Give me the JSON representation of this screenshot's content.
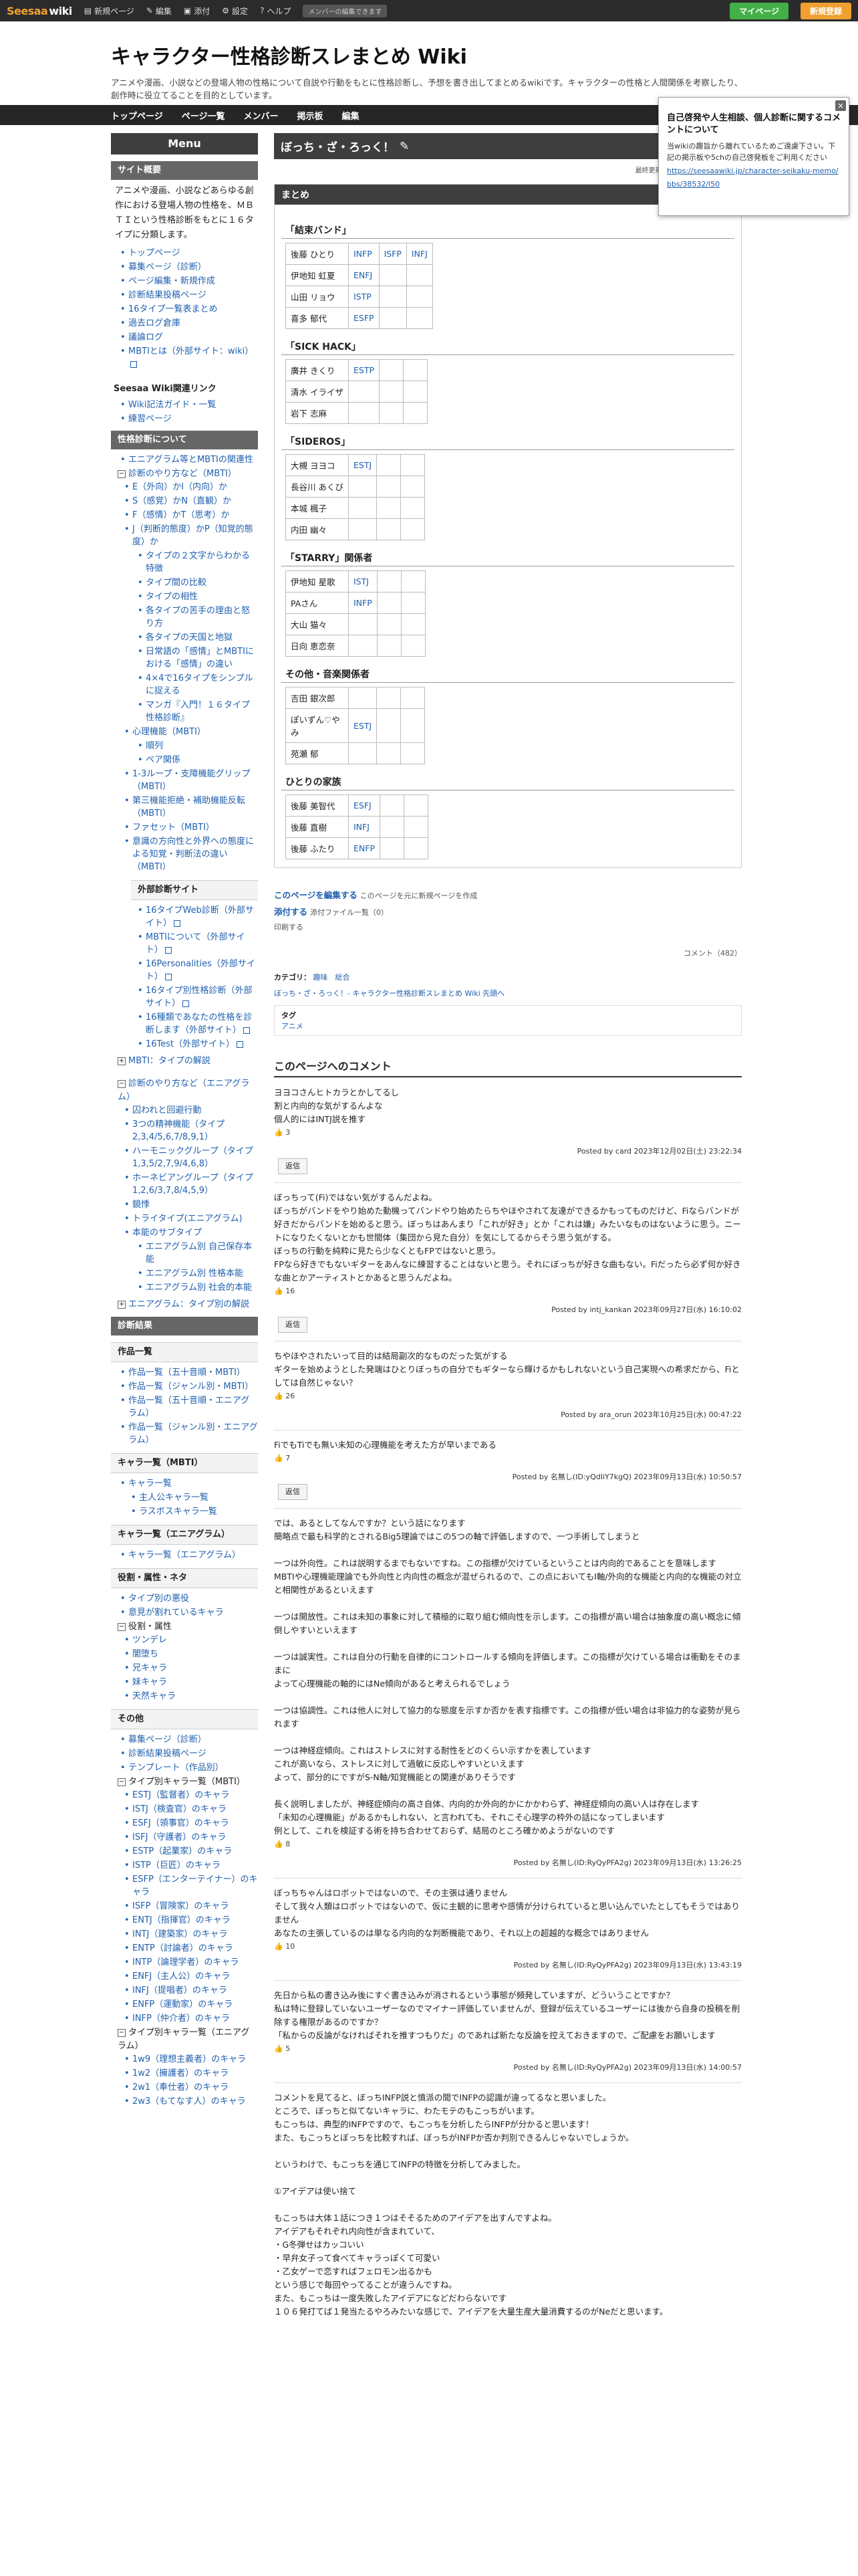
{
  "topbar": {
    "logo_main": "Seesaa",
    "logo_sub": "wiki",
    "items": [
      "新規ページ",
      "編集",
      "添付",
      "設定",
      "ヘルプ"
    ],
    "tag": "メンバーの編集できます",
    "btn_member": "マイページ",
    "btn_login": "新規登録"
  },
  "header": {
    "title": "キャラクター性格診断スレまとめ Wiki",
    "description": "アニメや漫画、小説などの登場人物の性格について自説や行動をもとに性格診断し、予想を書き出してまとめるwikiです。キャラクターの性格と人間関係を考察したり、創作時に役立てることを目的としています。"
  },
  "nav": {
    "items": [
      "トップページ",
      "ページ一覧",
      "メンバー",
      "掲示板",
      "編集"
    ],
    "search_button": "検索"
  },
  "popup": {
    "title": "自己啓発や人生相談、個人診断に関するコメントについて",
    "body": "当wikiの趣旨から離れているためご遠慮下さい。下記の掲示板や5chの自己啓発板をご利用ください",
    "link": "https://seesaawiki.jp/character-seikaku-memo/bbs/38532/l50"
  },
  "sidebar": {
    "menu_title": "Menu",
    "site_overview_title": "サイト概要",
    "site_overview_text": "アニメや漫画、小説などあらゆる創作における登場人物の性格を、ＭＢＴＩという性格診断をもとに１６タイプに分類します。",
    "links1": [
      "トップページ",
      "募集ページ（診断）",
      "ページ編集・新規作成",
      "診断結果投稿ページ",
      "16タイプ一覧表まとめ",
      "過去ログ倉庫",
      "議論ログ",
      "MBTIとは（外部サイト：wiki）"
    ],
    "wiki_links_title": "Seesaa Wiki関連リンク",
    "wiki_links": [
      "Wiki記法ガイド・一覧",
      "練習ページ"
    ],
    "diag_title": "性格診断について",
    "diag_links": [
      "エニアグラム等とMBTIの関連性",
      "診断のやり方など（MBTI）"
    ],
    "diag_sub": [
      "E（外向）かI（内向）か",
      "S（感覚）かN（直観）か",
      "F（感情）かT（思考）か",
      "J（判断的態度）かP（知覚的態度）か"
    ],
    "diag_sub2": [
      "タイプの２文字からわかる特徴",
      "タイプ間の比較",
      "タイプの相性",
      "各タイプの苦手の理由と怒り方",
      "各タイプの天国と地獄",
      "日常語の「感情」とMBTIにおける「感情」の違い",
      "4×4で16タイプをシンプルに捉える",
      "マンガ『入門！１６タイプ性格診断』"
    ],
    "cog_title": "心理機能（MBTI）",
    "cog_sub": [
      "順列",
      "ペア関係"
    ],
    "more_links": [
      "1-3ループ・支障機能グリップ（MBTI）",
      "第三機能拒絶・補助機能反転（MBTI）",
      "ファセット（MBTI）",
      "意識の方向性と外界への態度による知覚・判断法の違い（MBTI）"
    ],
    "ext_title": "外部診断サイト",
    "ext_links": [
      "16タイプWeb診断（外部サイト）",
      "MBTIについて（外部サイト）",
      "16Personalities（外部サイト）",
      "16タイプ別性格診断（外部サイト）",
      "16種類であなたの性格を診断します（外部サイト）",
      "16Test（外部サイト）"
    ],
    "mbti_list": "MBTI：タイプの解説",
    "ennea_title": "診断のやり方など（エニアグラム）",
    "ennea_links": [
      "囚われと回避行動",
      "3つの精神機能（タイプ2,3,4/5,6,7/8,9,1）",
      "ハーモニックグループ（タイプ1,3,5/2,7,9/4,6,8）",
      "ホーネビアングループ（タイプ1,2,6/3,7,8/4,5,9）",
      "鏡悸",
      "トライタイプ(エニアグラム)",
      "本能のサブタイプ"
    ],
    "ennea_sub": [
      "エニアグラム別 自己保存本能",
      "エニアグラム別 性格本能",
      "エニアグラム別 社会的本能"
    ],
    "ennea_list": "エニアグラム：タイプ別の解説",
    "result_title": "診断結果",
    "works_title": "作品一覧",
    "works_links": [
      "作品一覧（五十音順・MBTI）",
      "作品一覧（ジャンル別・MBTI）",
      "作品一覧（五十音順・エニアグラム）",
      "作品一覧（ジャンル別・エニアグラム）"
    ],
    "chars_title": "キャラ一覧（MBTI）",
    "chars_links": [
      "キャラ一覧"
    ],
    "chars_sub": [
      "主人公キャラ一覧",
      "ラスボスキャラ一覧"
    ],
    "chars_ennea_title": "キャラ一覧（エニアグラム）",
    "chars_ennea_links": [
      "キャラ一覧（エニアグラム）"
    ],
    "role_title": "役割・属性・ネタ",
    "role_links": [
      "タイプ別の悪役",
      "意見が割れているキャラ"
    ],
    "role_attr": "役割・属性",
    "role_attr_links": [
      "ツンデレ",
      "闇堕ち",
      "兄キャラ",
      "妹キャラ",
      "天然キャラ"
    ],
    "other_title": "その他",
    "other_links": [
      "募集ページ（診断）",
      "診断結果投稿ページ",
      "テンプレート（作品別）"
    ],
    "type_chars_title": "タイプ別キャラ一覧（MBTI）",
    "type_chars": [
      "ESTJ（監督者）のキャラ",
      "ISTJ（検査官）のキャラ",
      "ESFJ（領事官）のキャラ",
      "ISFJ（守護者）のキャラ",
      "ESTP（起業家）のキャラ",
      "ISTP（巨匠）のキャラ",
      "ESFP（エンターテイナー）のキャラ",
      "ISFP（冒険家）のキャラ",
      "ENTJ（指揮官）のキャラ",
      "INTJ（建築家）のキャラ",
      "ENTP（討論者）のキャラ",
      "INTP（論理学者）のキャラ",
      "ENFJ（主人公）のキャラ",
      "INFJ（提唱者）のキャラ",
      "ENFP（運動家）のキャラ",
      "INFP（仲介者）のキャラ"
    ],
    "type_ennea_title": "タイプ別キャラ一覧（エニアグラム）",
    "type_ennea": [
      "1w9（理想主義者）のキャラ",
      "1w2（擁護者）のキャラ",
      "2w1（奉仕者）のキャラ",
      "2w3（もてなす人）のキャラ"
    ]
  },
  "page": {
    "title": "ぼっち・ざ・ろっく！",
    "meta": "最終更新：ID:2b2mMKE1 2023年",
    "toc_title": "まとめ",
    "groups": [
      {
        "name": "「結束バンド」",
        "members": [
          [
            "後藤 ひとり",
            "INFP",
            "ISFP",
            "INFJ"
          ],
          [
            "伊地知 虹夏",
            "ENFJ",
            "",
            ""
          ],
          [
            "山田 リョウ",
            "ISTP",
            "",
            ""
          ],
          [
            "喜多 郁代",
            "ESFP",
            "",
            ""
          ]
        ]
      },
      {
        "name": "「SICK HACK」",
        "members": [
          [
            "廣井 きくり",
            "ESTP",
            "",
            ""
          ],
          [
            "清水 イライザ",
            "",
            "",
            ""
          ],
          [
            "岩下 志麻",
            "",
            "",
            ""
          ]
        ]
      },
      {
        "name": "「SIDEROS」",
        "members": [
          [
            "大槻 ヨヨコ",
            "ESTJ",
            "",
            ""
          ],
          [
            "長谷川 あくび",
            "",
            "",
            ""
          ],
          [
            "本城 楓子",
            "",
            "",
            ""
          ],
          [
            "内田 幽々",
            "",
            "",
            ""
          ]
        ]
      },
      {
        "name": "「STARRY」関係者",
        "members": [
          [
            "伊地知 星歌",
            "ISTJ",
            "",
            ""
          ],
          [
            "PAさん",
            "INFP",
            "",
            ""
          ],
          [
            "大山 猫々",
            "",
            "",
            ""
          ],
          [
            "日向 恵恋奈",
            "",
            "",
            ""
          ]
        ]
      },
      {
        "name": "その他・音楽関係者",
        "members": [
          [
            "吉田 銀次郎",
            "",
            "",
            ""
          ],
          [
            "ぽいずん♡やみ",
            "ESTJ",
            "",
            ""
          ],
          [
            "苑瀬 郁",
            "",
            "",
            ""
          ]
        ]
      },
      {
        "name": "ひとりの家族",
        "members": [
          [
            "後藤 美智代",
            "ESFJ",
            "",
            ""
          ],
          [
            "後藤 直樹",
            "INFJ",
            "",
            ""
          ],
          [
            "後藤 ふたり",
            "ENFP",
            "",
            ""
          ]
        ]
      }
    ],
    "edit_label": "このページを編集する",
    "edit_sub": "このページを元に新規ページを作成",
    "attach_label": "添付する",
    "attach_sub": "添付ファイル一覧（0）",
    "print_label": "印刷する",
    "comment_count": "コメント（482）",
    "category_label": "カテゴリ：",
    "categories": "趣味　総合",
    "breadcrumb": "ぼっち・ざ・ろっく！- キャラクター性格診断スレまとめ Wiki 先頭へ",
    "tag_title": "タグ",
    "tag": "アニメ",
    "comments_title": "このページへのコメント"
  },
  "comments": [
    {
      "text": "ヨヨコさんヒトカラとかしてるし\n割と内向的な気がするんよな\n個人的にはINTJ説を推す",
      "likes": "3",
      "author": "Posted by  card 2023年12月02日(土) 23:22:34",
      "reply_label": "返信"
    },
    {
      "text": "ぼっちって(Fi)ではない気がするんだよね。\nぼっちがバンドをやり始めた動機ってバンドやり始めたらちやほやされて友達ができるかもってものだけど、Fiならバンドが好きだからバンドを始めると思う。ぼっちはあんまり「これが好き」とか「これは嫌」みたいなものはないように思う。ニートになりたくないとかも世間体（集団から見た自分）を気にしてるからそう思う気がする。\nぼっちの行動を純粋に見たら少なくともFPではないと思う。\nFPなら好きでもないギターをあんなに練習することはないと思う。それにぼっちが好きな曲もない。Fiだったら必ず何か好きな曲とかアーティストとかあると思うんだよね。",
      "likes": "16",
      "author": "Posted by  intj_kankan 2023年09月27日(水) 16:10:02",
      "reply_label": "返信"
    },
    {
      "text": "ちやほやされたいって目的は結局副次的なものだった気がする\nギターを始めようとした発端はひとりぼっちの自分でもギターなら輝けるかもしれないという自己実現への希求だから、Fiとしては自然じゃない？",
      "likes": "26",
      "author": "Posted by  ara_orun 2023年10月25日(水) 00:47:22"
    },
    {
      "text": "FiでもTiでも無い未知の心理機能を考えた方が早いまである",
      "likes": "7",
      "author": "Posted by 名無し(ID:yQdIiY7kgQ) 2023年09月13日(水) 10:50:57",
      "reply_label": "返信"
    },
    {
      "text": "では、あるとしてなんですか？という話になります\n簡略点で最も科学的とされるBig5理論ではこの5つの軸で評価しますので、一つ手術してしまうと\n\n一つは外向性。これは説明するまでもないですね。この指標が欠けているということは内向的であることを意味します\nMBTIや心理機能理論でも外向性と内向性の概念が混ぜられるので、この点においてもI軸/外向的な機能と内向的な機能の対立と相関性があるといえます\n\n一つは開放性。これは未知の事象に対して積極的に取り組む傾向性を示します。この指標が高い場合は抽象度の高い概念に傾倒しやすいといえます\n\n一つは誠実性。これは自分の行動を自律的にコントロールする傾向を評価します。この指標が欠けている場合は衝動をそのままに\nよって心理機能の軸的にはNe傾向があると考えられるでしょう\n\n一つは協調性。これは他人に対して協力的な態度を示すか否かを表す指標です。この指標が低い場合は非協力的な姿勢が見られます\n\n一つは神経症傾向。これはストレスに対する耐性をどのくらい示すかを表しています\nこれが高いなら、ストレスに対して過敏に反応しやすいといえます\nよって、部分的にですがS-N軸/知覚機能との関連がありそうです\n\n長く説明しましたが、神経症傾向の高さ自体、内向的か外向的かにかかわらず、神経症傾向の高い人は存在します\n「未知の心理機能」があるかもしれない、と言われても、それこそ心理学の枠外の話になってしまいます\n例として、これを検証する術を持ち合わせておらず、結局のところ確かめようがないのです",
      "likes": "8",
      "author": "Posted by 名無し(ID:RyQyPFA2g) 2023年09月13日(水) 13:26:25"
    },
    {
      "text": "ぼっちちゃんはロボットではないので、その主張は通りません\nそして我々人類はロボットではないので、仮に主観的に思考や感情が分けられていると思い込んでいたとしてもそうではありません\nあなたの主張しているのは単なる内向的な判断機能であり、それ以上の超越的な概念ではありません",
      "likes": "10",
      "author": "Posted by 名無し(ID:RyQyPFA2g) 2023年09月13日(水) 13:43:19"
    },
    {
      "text": "先日から私の書き込み後にすぐ書き込みが消されるという事態が頻発していますが、どういうことですか？\n私は特に登録していないユーザーなのでマイナー評価していませんが、登録が伝えているユーザーには後から自身の投稿を削除する権限があるのですか？\n「私からの反論がなければそれを推すつもりだ」のであれば新たな反論を控えておきますので、ご配慮をお願いします",
      "likes": "5",
      "author": "Posted by 名無し(ID:RyQyPFA2g) 2023年09月13日(水) 14:00:57"
    },
    {
      "text": "コメントを見てると、ぼっちINFP説と憤派の間でINFPの認識が違ってるなと思いました。\nところで、ぼっちと似てないキャラに、わたモテのもこっちがいます。\nもこっちは、典型的INFPですので、もこっちを分析したらINFPが分かると思います！\nまた、もこっちとぼっちを比較すれば、ぼっちがINFPか否か判別できるんじゃないでしょうか。\n\nというわけで、もこっちを通じてINFPの特徴を分析してみました。\n\n①アイデアは使い捨て\n\nもこっちは大体１話につき１つはそそるためのアイデアを出すんですよね。\nアイデアもそれぞれ内向性が含まれていて、\n・G冬弾せはカッコいい\n・早弁女子って食べてキャラっぽくて可愛い\n・乙女ゲーで恋すればフェロモン出るかも\nという感じで毎回やってることが違うんですね。\nまた、もこっちは一度失敗したアイデアになどだわらないです\n１０６発打てば１発当たるやろみたいな感じで、アイデアを大量生産大量消費するのがNeだと思います。"
    }
  ]
}
